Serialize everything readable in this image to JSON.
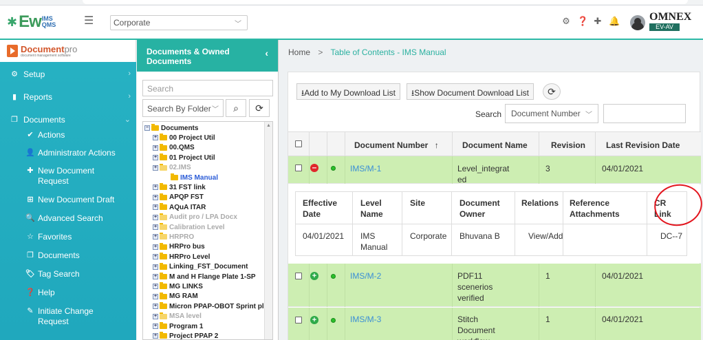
{
  "header": {
    "logo_main": "Ew",
    "logo_sup_top": "IMS",
    "logo_sup_bottom": "QMS",
    "org_select_value": "Corporate",
    "brand_name": "OMNEX",
    "brand_sub": "EV-AV"
  },
  "leftnav": {
    "brand_title": "Document",
    "brand_title_suffix": "pro",
    "brand_tagline": "document management software",
    "items": [
      {
        "label": "Setup",
        "icon": "gears-icon"
      },
      {
        "label": "Reports",
        "icon": "report-icon"
      },
      {
        "label": "Documents",
        "icon": "documents-icon"
      }
    ],
    "subitems": [
      {
        "label": "Actions",
        "icon": "check-icon"
      },
      {
        "label": "Administrator Actions",
        "icon": "user-edit-icon"
      },
      {
        "label": "New Document Request",
        "icon": "plus-icon"
      },
      {
        "label": "New Document Draft",
        "icon": "plus-square-icon"
      },
      {
        "label": "Advanced Search",
        "icon": "search-icon"
      },
      {
        "label": "Favorites",
        "icon": "star-icon"
      },
      {
        "label": "Documents",
        "icon": "copy-icon"
      },
      {
        "label": "Tag Search",
        "icon": "tag-icon"
      },
      {
        "label": "Help",
        "icon": "help-icon"
      },
      {
        "label": "Initiate Change Request",
        "icon": "edit-icon"
      }
    ]
  },
  "tree": {
    "title": "Documents & Owned Documents",
    "search_placeholder": "Search",
    "folder_select": "Search By Folder",
    "nodes": [
      {
        "label": "Documents",
        "level": 0,
        "state": "normal"
      },
      {
        "label": "00 Project Util",
        "level": 1,
        "state": "normal"
      },
      {
        "label": "00.QMS",
        "level": 1,
        "state": "normal"
      },
      {
        "label": "01 Project Util",
        "level": 1,
        "state": "normal"
      },
      {
        "label": "02.IMS",
        "level": 1,
        "state": "dim"
      },
      {
        "label": "IMS Manual",
        "level": 2,
        "state": "active"
      },
      {
        "label": "31 FST link",
        "level": 1,
        "state": "normal"
      },
      {
        "label": "APQP FST",
        "level": 1,
        "state": "normal"
      },
      {
        "label": "AQuA ITAR",
        "level": 1,
        "state": "normal"
      },
      {
        "label": "Audit pro / LPA Docx",
        "level": 1,
        "state": "dim"
      },
      {
        "label": "Calibration Level",
        "level": 1,
        "state": "dim"
      },
      {
        "label": "HRPRO",
        "level": 1,
        "state": "dim"
      },
      {
        "label": "HRPro bus",
        "level": 1,
        "state": "normal"
      },
      {
        "label": "HRPro Level",
        "level": 1,
        "state": "normal"
      },
      {
        "label": "Linking_FST_Document",
        "level": 1,
        "state": "normal"
      },
      {
        "label": "M and H Flange Plate 1-SP",
        "level": 1,
        "state": "normal"
      },
      {
        "label": "MG LINKS",
        "level": 1,
        "state": "normal"
      },
      {
        "label": "MG RAM",
        "level": 1,
        "state": "normal"
      },
      {
        "label": "Micron PPAP-OBOT Sprint pl",
        "level": 1,
        "state": "normal"
      },
      {
        "label": "MSA level",
        "level": 1,
        "state": "dim"
      },
      {
        "label": "Program 1",
        "level": 1,
        "state": "normal"
      },
      {
        "label": "Project PPAP 2",
        "level": 1,
        "state": "normal"
      }
    ]
  },
  "breadcrumb": {
    "home": "Home",
    "separator": ">",
    "current": "Table of Contents - IMS Manual"
  },
  "toolbar": {
    "add_download": "Add to My Download List",
    "show_download": "Show Document Download List",
    "search_label": "Search",
    "search_field_value": "Document Number"
  },
  "table": {
    "headers": {
      "doc_number": "Document Number",
      "sort_arrow": "↑",
      "doc_name": "Document Name",
      "revision": "Revision",
      "last_rev_date": "Last Revision Date"
    },
    "rows": [
      {
        "number": "IMS/M-1",
        "name_lines": [
          "Level_integrat",
          "ed"
        ],
        "revision": "3",
        "date": "04/01/2021",
        "expanded": true
      },
      {
        "number": "IMS/M-2",
        "name_lines": [
          "PDF11",
          "scenerios",
          "verified"
        ],
        "revision": "1",
        "date": "04/01/2021",
        "expanded": false
      },
      {
        "number": "IMS/M-3",
        "name_lines": [
          "Stitch",
          "Document",
          "workflow"
        ],
        "revision": "1",
        "date": "04/01/2021",
        "expanded": false
      }
    ],
    "detail": {
      "headers": [
        [
          "Effective",
          "Date"
        ],
        [
          "Level",
          "Name"
        ],
        [
          "Site"
        ],
        [
          "Document",
          "Owner"
        ],
        [
          "Relations"
        ],
        [
          "Reference",
          "Attachments"
        ],
        [
          "CR",
          "Link"
        ]
      ],
      "values": {
        "effective_date": "04/01/2021",
        "level_name_lines": [
          "IMS",
          "Manual"
        ],
        "site": "Corporate",
        "owner": "Bhuvana B",
        "relations": "View/Add",
        "reference_attachments": "",
        "cr_link": "DC--7"
      }
    }
  },
  "colors": {
    "teal": "#27b2a3",
    "row_green": "#cdeeb2",
    "link_blue": "#3a8fd6",
    "annotation_red": "#e3151e"
  }
}
